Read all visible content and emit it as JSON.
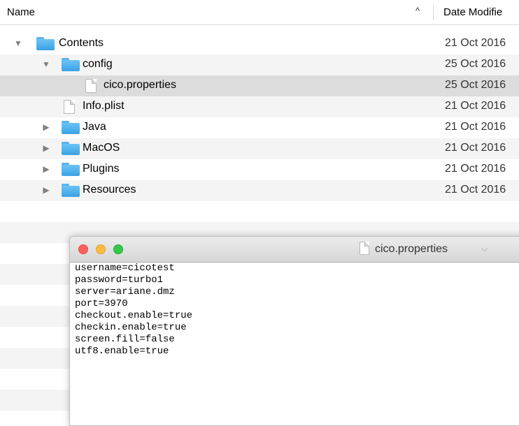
{
  "finder": {
    "columns": {
      "name": "Name",
      "date": "Date Modifie",
      "sort_indicator": "^"
    },
    "rows": [
      {
        "name": "Contents",
        "date": "21 Oct 2016",
        "kind": "folder",
        "disclosure": "expanded",
        "level": 0
      },
      {
        "name": "config",
        "date": "25 Oct 2016",
        "kind": "folder",
        "disclosure": "expanded",
        "level": 1
      },
      {
        "name": "cico.properties",
        "date": "25 Oct 2016",
        "kind": "file",
        "selected": true,
        "level": 2
      },
      {
        "name": "Info.plist",
        "date": "21 Oct 2016",
        "kind": "file",
        "level": 1
      },
      {
        "name": "Java",
        "date": "21 Oct 2016",
        "kind": "folder",
        "disclosure": "collapsed",
        "level": 1
      },
      {
        "name": "MacOS",
        "date": "21 Oct 2016",
        "kind": "folder",
        "disclosure": "collapsed",
        "level": 1
      },
      {
        "name": "Plugins",
        "date": "21 Oct 2016",
        "kind": "folder",
        "disclosure": "collapsed",
        "level": 1
      },
      {
        "name": "Resources",
        "date": "21 Oct 2016",
        "kind": "folder",
        "disclosure": "collapsed",
        "level": 1
      }
    ],
    "glyphs": {
      "expanded": "▼",
      "collapsed": "▶"
    }
  },
  "editor": {
    "title": "cico.properties",
    "title_chevron": "⌵",
    "lines": [
      "username=cicotest",
      "password=turbo1",
      "server=ariane.dmz",
      "port=3970",
      "checkout.enable=true",
      "checkin.enable=true",
      "screen.fill=false",
      "utf8.enable=true"
    ]
  },
  "colors": {
    "folder": "#3aa2e4",
    "selection": "#dcdcdc",
    "close": "#fc605c",
    "minimize": "#fdbc40",
    "maximize": "#34c84a"
  },
  "icons": [
    "folder-icon",
    "document-icon",
    "disclosure-triangle-icon"
  ]
}
